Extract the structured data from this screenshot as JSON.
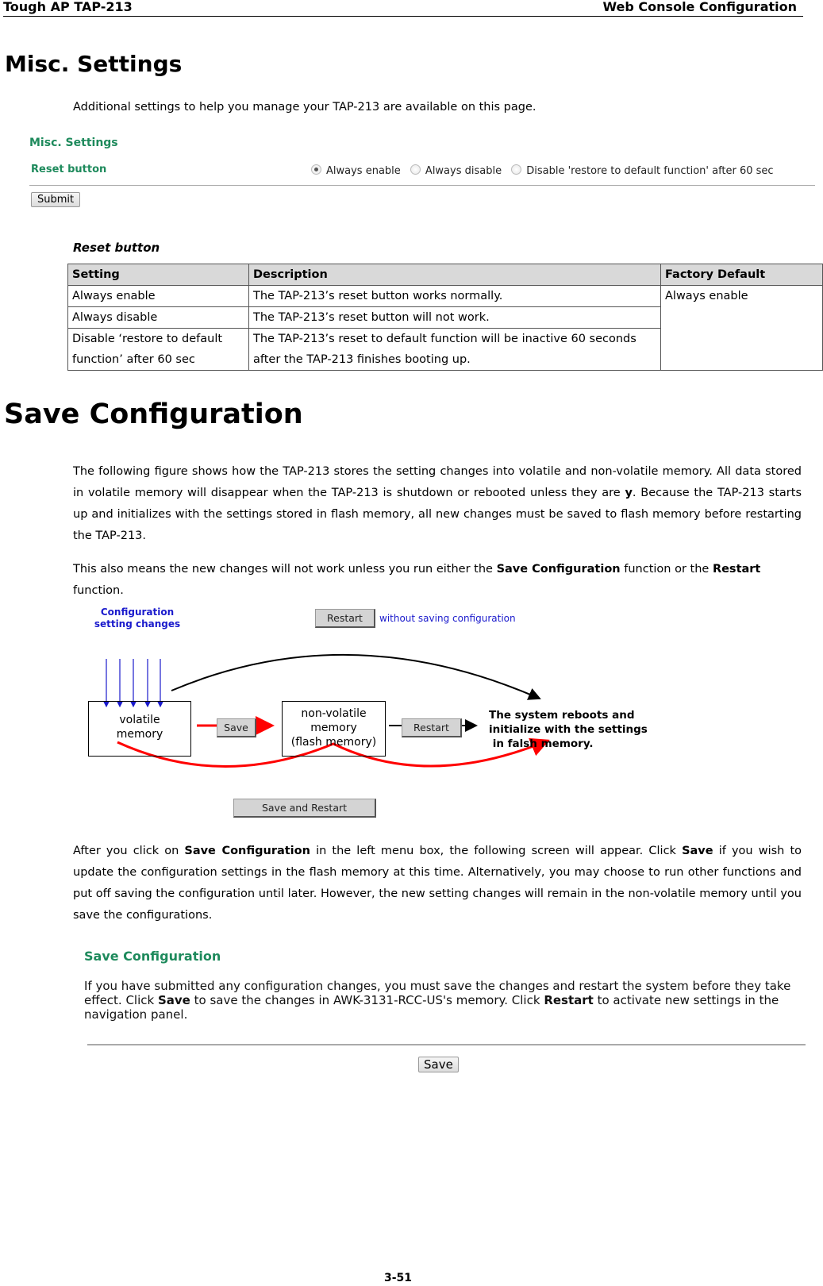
{
  "header": {
    "left": "Tough AP TAP-213",
    "right": "Web Console Configuration"
  },
  "misc": {
    "title": "Misc. Settings",
    "intro": "Additional settings to help you manage your TAP-213 are available on this page.",
    "screenshot": {
      "panel_title": "Misc. Settings",
      "field_label": "Reset button",
      "options": [
        {
          "label": "Always enable",
          "selected": true
        },
        {
          "label": "Always disable",
          "selected": false
        },
        {
          "label": "Disable 'restore to default function' after 60 sec",
          "selected": false
        }
      ],
      "submit_label": "Submit"
    },
    "table_caption": "Reset button",
    "table": {
      "headers": [
        "Setting",
        "Description",
        "Factory Default"
      ],
      "rows": [
        {
          "setting": "Always enable",
          "description": "The TAP-213’s reset button works normally."
        },
        {
          "setting": "Always disable",
          "description": "The TAP-213’s reset button will not work."
        },
        {
          "setting": "Disable ‘restore to default function’ after 60 sec",
          "description": "The TAP-213’s reset to default function will be inactive 60 seconds after the TAP-213 finishes booting up."
        }
      ],
      "factory_default": "Always enable"
    }
  },
  "save": {
    "title": "Save Configuration",
    "para1": "The following figure shows how the TAP-213 stores the setting changes into volatile and non-volatile memory. All data stored in volatile memory will disappear when the TAP-213 is shutdown or rebooted unless they are ",
    "para1_bold": "y",
    "para1_end": ". Because the TAP-213 starts up and initializes with the settings stored in flash memory, all new changes must be saved to flash memory before restarting the TAP-213.",
    "para2_a": "This also means the new changes will not work unless you run either the ",
    "para2_b1": "Save Configuration",
    "para2_c": " function or the ",
    "para2_b2": "Restart",
    "para2_d": " function.",
    "diagram": {
      "config_label_1": "Configuration",
      "config_label_2": "setting changes",
      "restart_top_label": "Restart",
      "restart_top_note": "without saving configuration",
      "volatile_1": "volatile",
      "volatile_2": "memory",
      "save_label": "Save",
      "nonvolatile_1": "non-volatile",
      "nonvolatile_2": "memory",
      "nonvolatile_3": "(flash memory)",
      "restart_mid_label": "Restart",
      "reboot_1": "The system reboots and",
      "reboot_2": "initialize with the settings",
      "reboot_3": " in falsh memory.",
      "save_restart_label": "Save and Restart"
    },
    "para3_a": "After you click on ",
    "para3_b1": "Save Configuration",
    "para3_c": " in the left menu box, the following screen will appear. Click ",
    "para3_b2": "Save",
    "para3_d": " if you wish to update the configuration settings in the flash memory at this time. Alternatively, you may choose to run other functions and put off saving the configuration until later. However, the new setting changes will remain in the non-volatile memory until you save the configurations.",
    "screenshot": {
      "title": "Save Configuration",
      "text_a": "If you have submitted any configuration changes, you must save the changes and restart the system before they take effect. Click ",
      "text_b1": "Save",
      "text_c": " to save the changes in AWK-3131-RCC-US's memory. Click ",
      "text_b2": "Restart",
      "text_d": " to activate new settings in the navigation panel.",
      "save_button": "Save"
    }
  },
  "footer": {
    "page_number": "3-51"
  }
}
